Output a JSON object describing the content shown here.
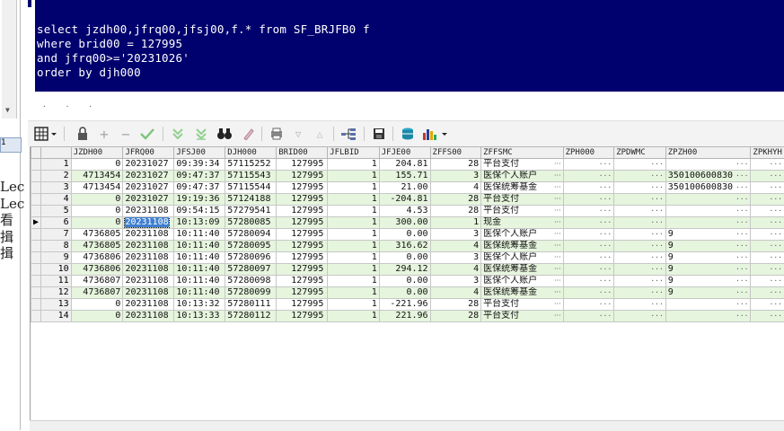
{
  "sql": {
    "lines": [
      "select jzdh00,jfrq00,jfsj00,f.* from SF_BRJFB0 f",
      "where brid00 = 127995",
      "and jfrq00>='20231026'",
      "order by djh000"
    ]
  },
  "side_labels": [
    "Lec",
    "Lec",
    "看",
    "揖",
    "揖"
  ],
  "side_tab": "1",
  "toolbar": {
    "icons": [
      "grid-icon",
      "lock-icon",
      "add-icon",
      "remove-icon",
      "check-icon",
      "filter-icon",
      "filter-clear-icon",
      "binoculars-icon",
      "eraser-icon",
      "print-icon",
      "arrow-down-icon",
      "arrow-up-icon",
      "tree-icon",
      "save-icon",
      "database-icon",
      "chart-icon"
    ]
  },
  "grid": {
    "columns": [
      "JZDH00",
      "JFRQ00",
      "JFSJ00",
      "DJH000",
      "BRID00",
      "JFLBID",
      "JFJE00",
      "ZFFS00",
      "ZFFSMC",
      "ZPH000",
      "ZPDWMC",
      "ZPZH00",
      "ZPKHYH"
    ],
    "current_row": 6,
    "selected_cell": "20231108",
    "rows": [
      {
        "n": "1",
        "jzdh": "0",
        "jfrq": "20231027",
        "jfsj": "09:39:34",
        "djh": "57115252",
        "brid": "127995",
        "jflb": "1",
        "jfje": "204.81",
        "zffs": "28",
        "zffsmc": "平台支付",
        "zpzh": ""
      },
      {
        "n": "2",
        "jzdh": "4713454",
        "jfrq": "20231027",
        "jfsj": "09:47:37",
        "djh": "57115543",
        "brid": "127995",
        "jflb": "1",
        "jfje": "155.71",
        "zffs": "3",
        "zffsmc": "医保个人账户",
        "zpzh": "350100600830"
      },
      {
        "n": "3",
        "jzdh": "4713454",
        "jfrq": "20231027",
        "jfsj": "09:47:37",
        "djh": "57115544",
        "brid": "127995",
        "jflb": "1",
        "jfje": "21.00",
        "zffs": "4",
        "zffsmc": "医保统筹基金",
        "zpzh": "350100600830"
      },
      {
        "n": "4",
        "jzdh": "0",
        "jfrq": "20231027",
        "jfsj": "19:19:36",
        "djh": "57124188",
        "brid": "127995",
        "jflb": "1",
        "jfje": "-204.81",
        "zffs": "28",
        "zffsmc": "平台支付",
        "zpzh": ""
      },
      {
        "n": "5",
        "jzdh": "0",
        "jfrq": "20231108",
        "jfsj": "09:54:15",
        "djh": "57279541",
        "brid": "127995",
        "jflb": "1",
        "jfje": "4.53",
        "zffs": "28",
        "zffsmc": "平台支付",
        "zpzh": ""
      },
      {
        "n": "6",
        "jzdh": "0",
        "jfrq": "20231108",
        "jfsj": "10:13:09",
        "djh": "57280085",
        "brid": "127995",
        "jflb": "1",
        "jfje": "300.00",
        "zffs": "1",
        "zffsmc": "现金",
        "zpzh": ""
      },
      {
        "n": "7",
        "jzdh": "4736805",
        "jfrq": "20231108",
        "jfsj": "10:11:40",
        "djh": "57280094",
        "brid": "127995",
        "jflb": "1",
        "jfje": "0.00",
        "zffs": "3",
        "zffsmc": "医保个人账户",
        "zpzh": "9"
      },
      {
        "n": "8",
        "jzdh": "4736805",
        "jfrq": "20231108",
        "jfsj": "10:11:40",
        "djh": "57280095",
        "brid": "127995",
        "jflb": "1",
        "jfje": "316.62",
        "zffs": "4",
        "zffsmc": "医保统筹基金",
        "zpzh": "9"
      },
      {
        "n": "9",
        "jzdh": "4736806",
        "jfrq": "20231108",
        "jfsj": "10:11:40",
        "djh": "57280096",
        "brid": "127995",
        "jflb": "1",
        "jfje": "0.00",
        "zffs": "3",
        "zffsmc": "医保个人账户",
        "zpzh": "9"
      },
      {
        "n": "10",
        "jzdh": "4736806",
        "jfrq": "20231108",
        "jfsj": "10:11:40",
        "djh": "57280097",
        "brid": "127995",
        "jflb": "1",
        "jfje": "294.12",
        "zffs": "4",
        "zffsmc": "医保统筹基金",
        "zpzh": "9"
      },
      {
        "n": "11",
        "jzdh": "4736807",
        "jfrq": "20231108",
        "jfsj": "10:11:40",
        "djh": "57280098",
        "brid": "127995",
        "jflb": "1",
        "jfje": "0.00",
        "zffs": "3",
        "zffsmc": "医保个人账户",
        "zpzh": "9"
      },
      {
        "n": "12",
        "jzdh": "4736807",
        "jfrq": "20231108",
        "jfsj": "10:11:40",
        "djh": "57280099",
        "brid": "127995",
        "jflb": "1",
        "jfje": "0.00",
        "zffs": "4",
        "zffsmc": "医保统筹基金",
        "zpzh": "9"
      },
      {
        "n": "13",
        "jzdh": "0",
        "jfrq": "20231108",
        "jfsj": "10:13:32",
        "djh": "57280111",
        "brid": "127995",
        "jflb": "1",
        "jfje": "-221.96",
        "zffs": "28",
        "zffsmc": "平台支付",
        "zpzh": ""
      },
      {
        "n": "14",
        "jzdh": "0",
        "jfrq": "20231108",
        "jfsj": "10:13:33",
        "djh": "57280112",
        "brid": "127995",
        "jflb": "1",
        "jfje": "221.96",
        "zffs": "28",
        "zffsmc": "平台支付",
        "zpzh": ""
      }
    ]
  },
  "colors": {
    "editor_bg": "#00006e",
    "row_even": "#e6f5dd",
    "selection": "#3f7fd0"
  }
}
